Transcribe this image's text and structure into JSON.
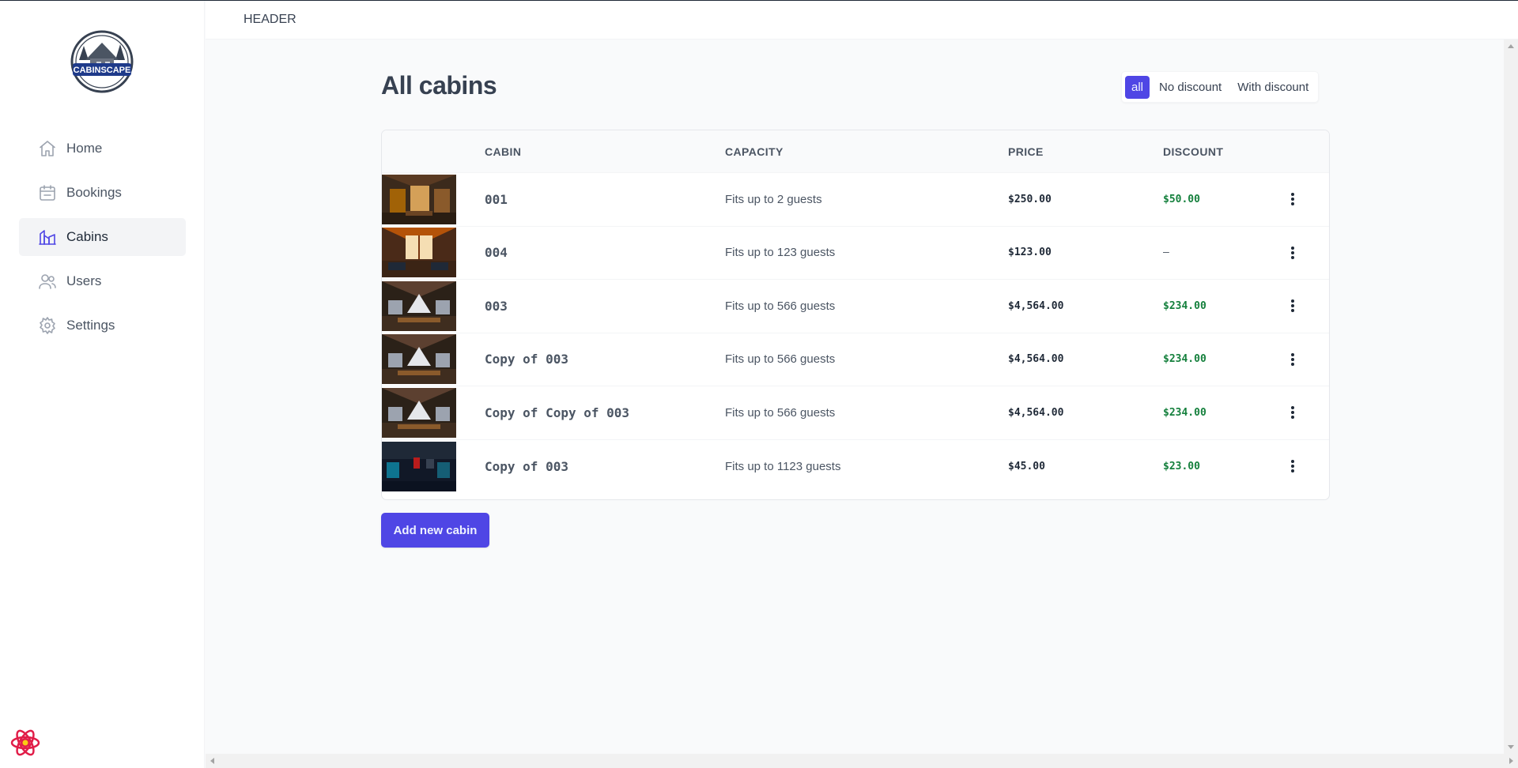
{
  "header": {
    "title": "HEADER"
  },
  "logo": {
    "text": "CABINSCAPE"
  },
  "sidebar": {
    "items": [
      {
        "label": "Home",
        "icon": "home-icon",
        "active": false
      },
      {
        "label": "Bookings",
        "icon": "calendar-icon",
        "active": false
      },
      {
        "label": "Cabins",
        "icon": "cabin-icon",
        "active": true
      },
      {
        "label": "Users",
        "icon": "users-icon",
        "active": false
      },
      {
        "label": "Settings",
        "icon": "gear-icon",
        "active": false
      }
    ]
  },
  "page": {
    "title": "All cabins",
    "filter": {
      "options": [
        "all",
        "No discount",
        "With discount"
      ],
      "active": "all"
    },
    "table": {
      "headers": [
        "",
        "CABIN",
        "CAPACITY",
        "PRICE",
        "DISCOUNT",
        ""
      ],
      "rows": [
        {
          "name": "001",
          "capacity": "Fits up to 2 guests",
          "price": "$250.00",
          "discount": "$50.00",
          "image": "cabin-photo-warm"
        },
        {
          "name": "004",
          "capacity": "Fits up to 123 guests",
          "price": "$123.00",
          "discount": "—",
          "image": "cabin-photo-orange"
        },
        {
          "name": "003",
          "capacity": "Fits up to 566 guests",
          "price": "$4,564.00",
          "discount": "$234.00",
          "image": "cabin-photo-dark"
        },
        {
          "name": "Copy of 003",
          "capacity": "Fits up to 566 guests",
          "price": "$4,564.00",
          "discount": "$234.00",
          "image": "cabin-photo-dark"
        },
        {
          "name": "Copy of Copy of 003",
          "capacity": "Fits up to 566 guests",
          "price": "$4,564.00",
          "discount": "$234.00",
          "image": "cabin-photo-dark"
        },
        {
          "name": "Copy of 003",
          "capacity": "Fits up to 1123 guests",
          "price": "$45.00",
          "discount": "$23.00",
          "image": "cabin-photo-night"
        }
      ]
    },
    "add_button": "Add new cabin"
  },
  "colors": {
    "accent": "#4f46e5",
    "discount_green": "#15803d",
    "background": "#f9fafb"
  }
}
